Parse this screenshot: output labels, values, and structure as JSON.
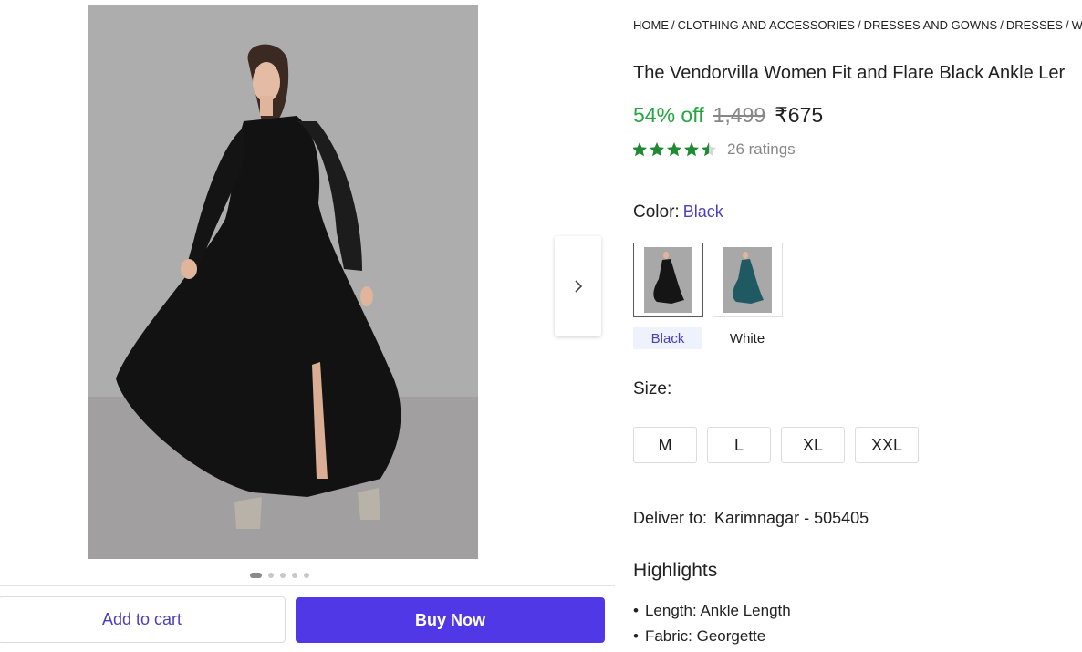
{
  "breadcrumb": [
    "HOME",
    "CLOTHING AND ACCESSORIES",
    "DRESSES AND GOWNS",
    "DRESSES",
    "WOM"
  ],
  "product": {
    "title": "The Vendorvilla Women Fit and Flare Black Ankle Ler",
    "discount": "54% off",
    "mrp": "1,499",
    "price": "₹675",
    "rating_value": 4.5,
    "ratings_count": "26 ratings"
  },
  "color": {
    "label": "Color:",
    "selected": "Black",
    "options": [
      {
        "label": "Black",
        "dress_color": "#151515"
      },
      {
        "label": "White",
        "dress_color": "#1f5a63"
      }
    ]
  },
  "size": {
    "label": "Size:",
    "options": [
      "M",
      "L",
      "XL",
      "XXL"
    ]
  },
  "delivery": {
    "label": "Deliver to:",
    "location": "Karimnagar - 505405"
  },
  "highlights": {
    "title": "Highlights",
    "items": [
      "Length: Ankle Length",
      "Fabric: Georgette"
    ]
  },
  "actions": {
    "add_to_cart": "Add to cart",
    "buy_now": "Buy Now"
  },
  "gallery": {
    "image_count": 5,
    "active_index": 0
  },
  "colors": {
    "accent": "#5038e6",
    "discount_green": "#26a541",
    "star_green": "#1e8a32",
    "link_purple": "#4b3fbf"
  }
}
